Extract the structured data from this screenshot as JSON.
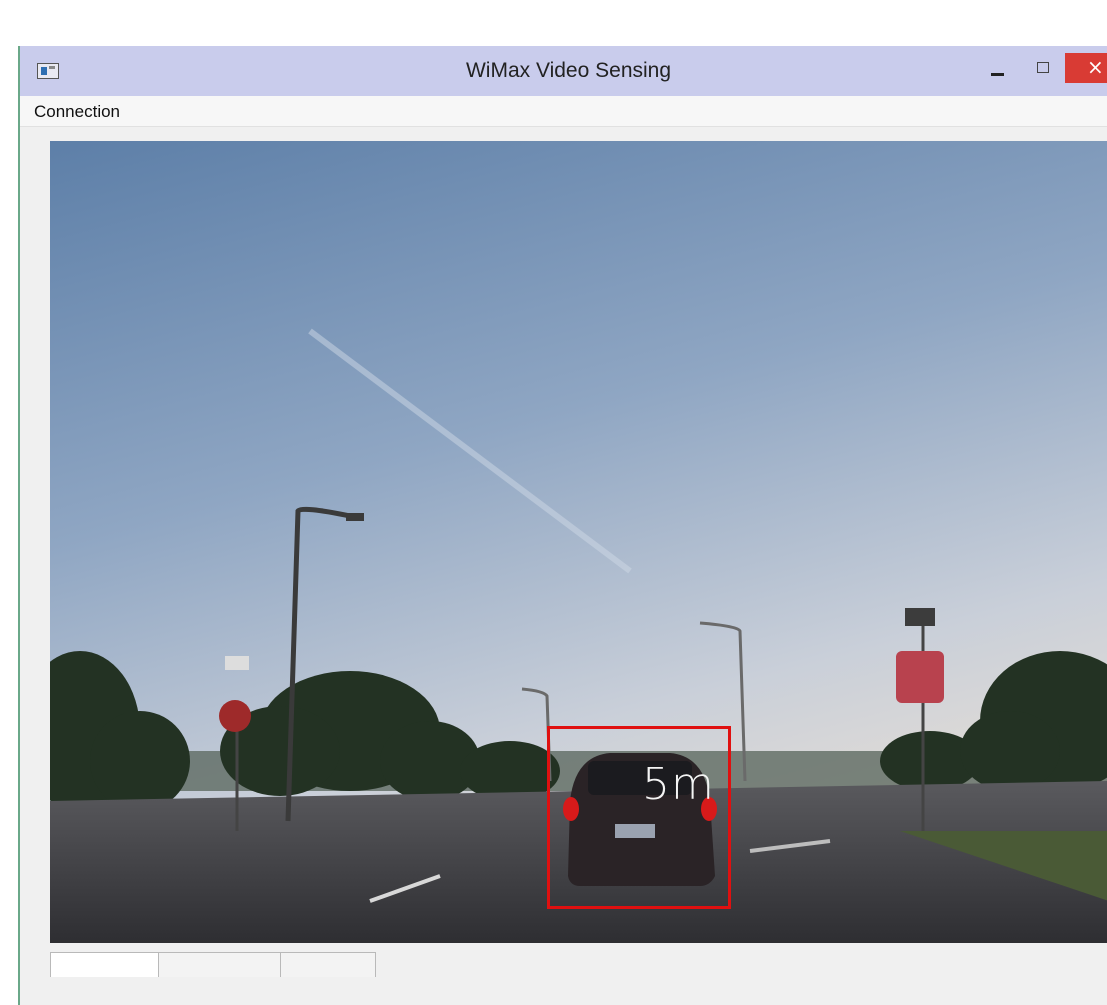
{
  "window": {
    "title": "WiMax Video Sensing",
    "close_glyph": "×"
  },
  "menu": {
    "items": [
      "Connection"
    ]
  },
  "video": {
    "detection_label": "5m",
    "detection_box_color": "#e01010"
  },
  "colors": {
    "titlebar": "#c9ccec",
    "close_button": "#d93b34"
  }
}
